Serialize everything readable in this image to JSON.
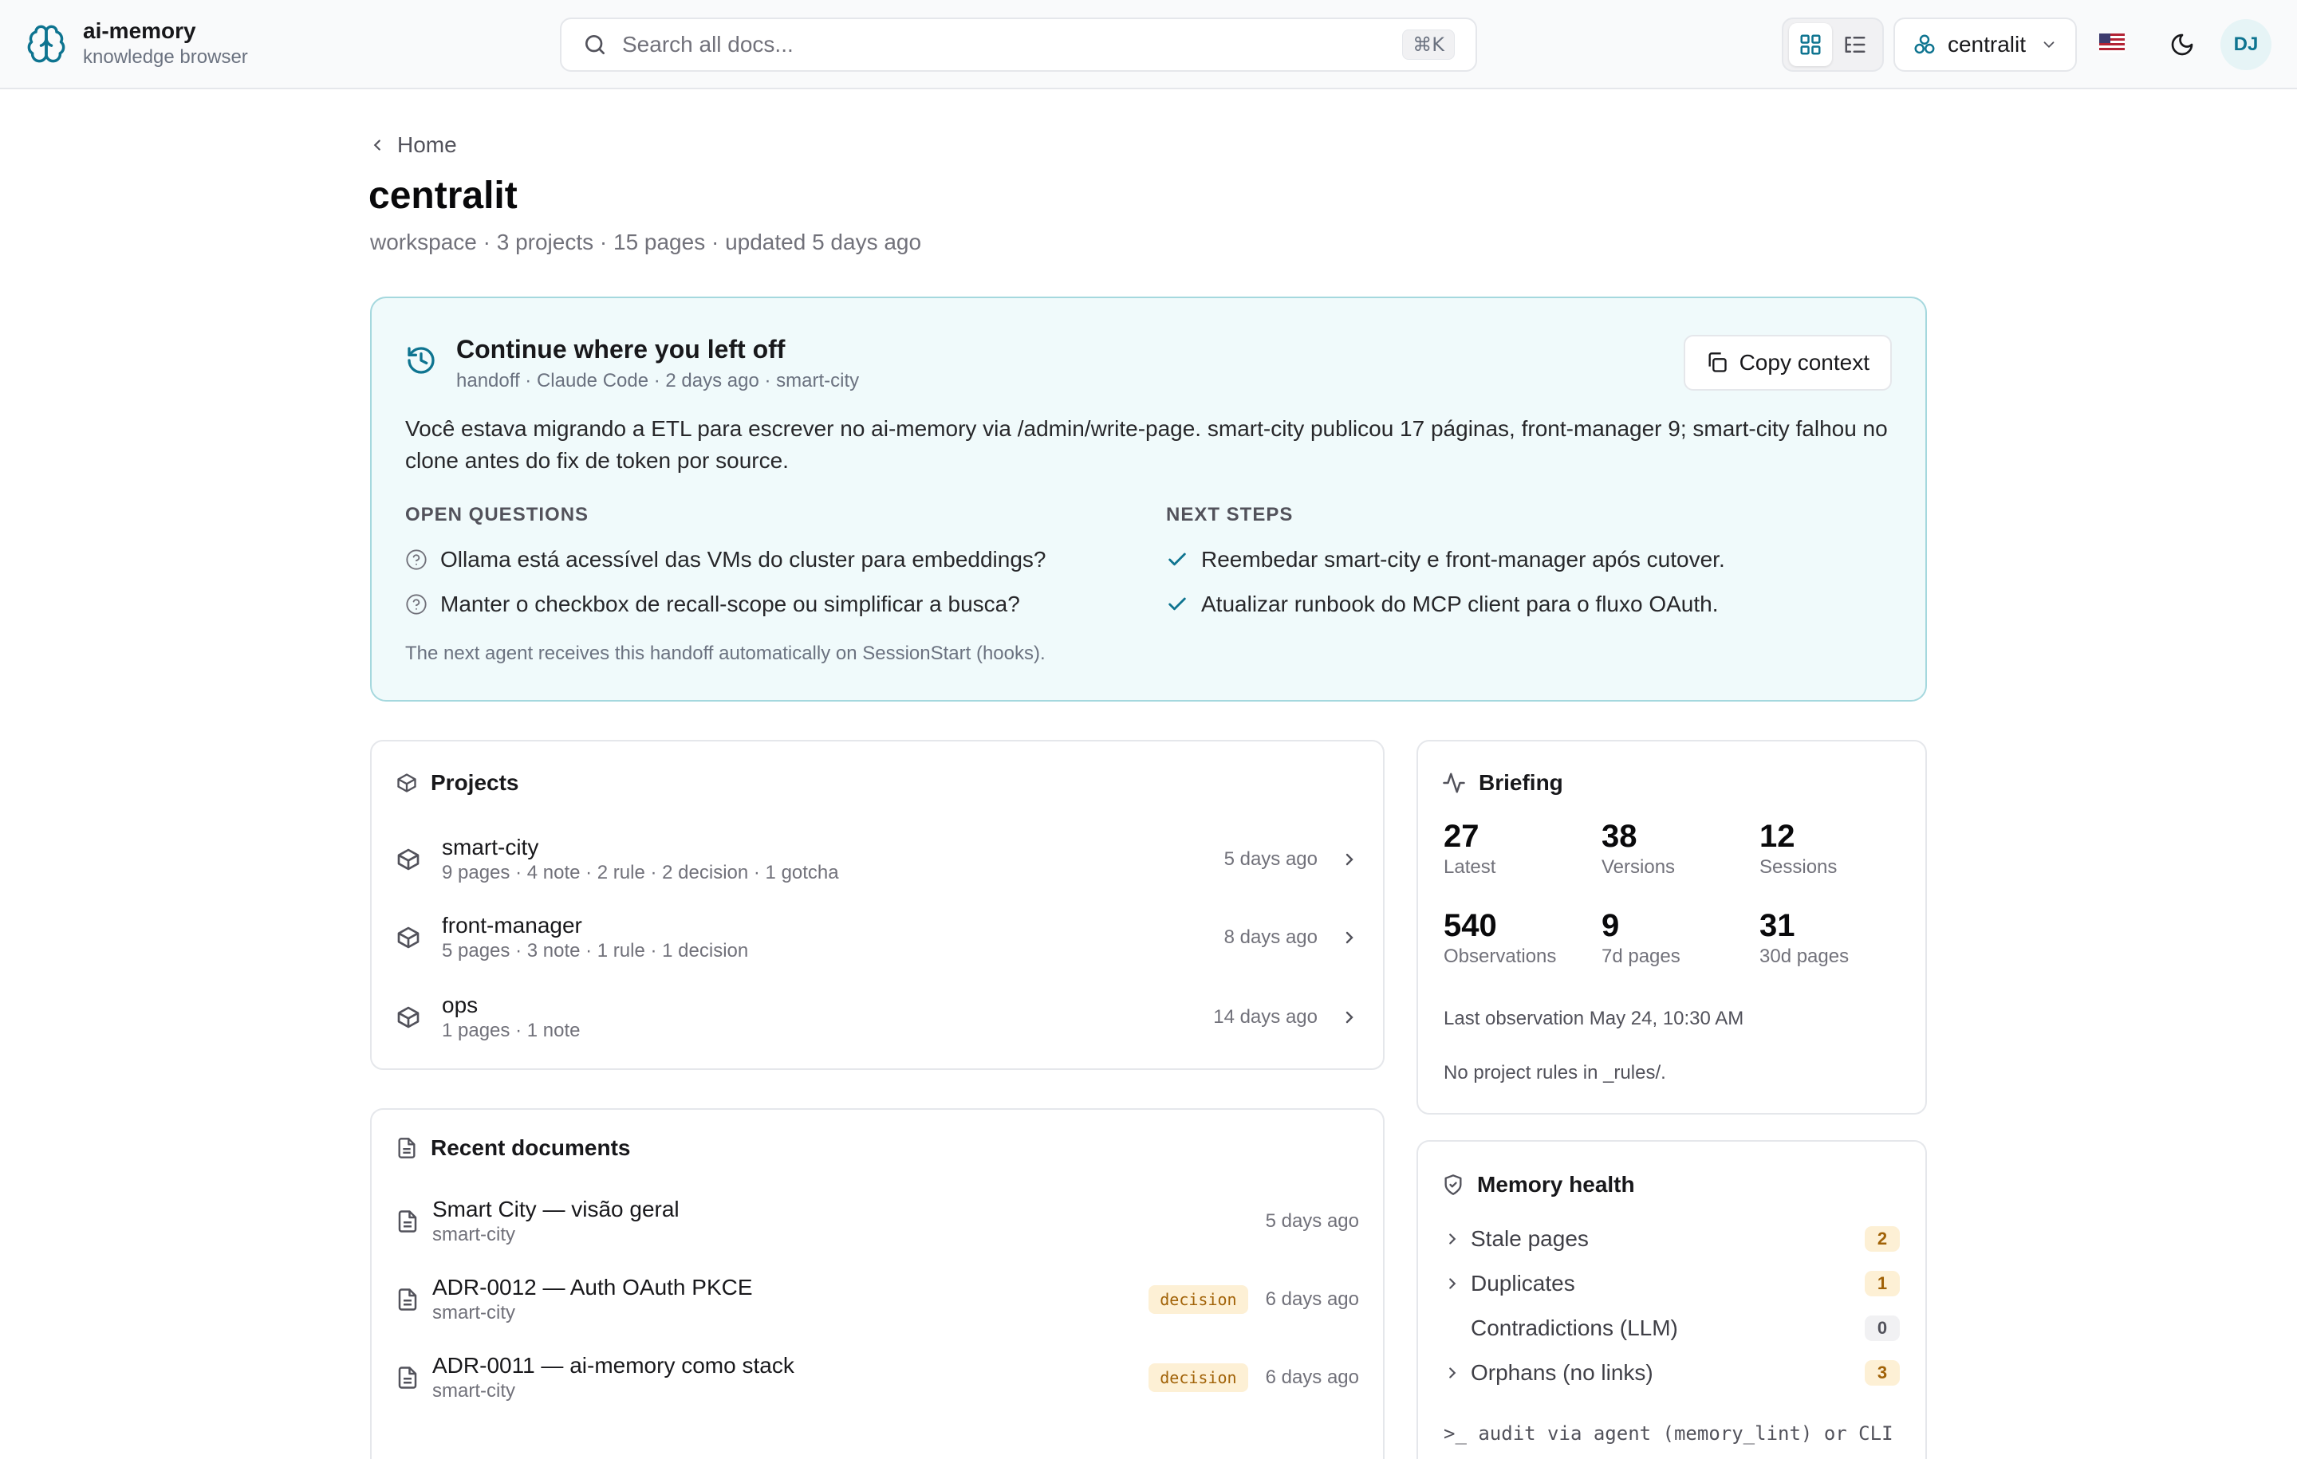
{
  "app": {
    "title": "ai-memory",
    "subtitle": "knowledge browser"
  },
  "search": {
    "placeholder": "Search all docs...",
    "shortcut": "⌘K"
  },
  "workspace_selector": {
    "value": "centralit"
  },
  "user": {
    "initials": "DJ"
  },
  "breadcrumb": {
    "back_label": "Home"
  },
  "page": {
    "title": "centralit",
    "meta": "workspace · 3 projects · 15 pages · updated 5 days ago"
  },
  "handoff": {
    "title": "Continue where you left off",
    "subtitle": "handoff · Claude Code · 2 days ago · smart-city",
    "copy_label": "Copy context",
    "summary": "Você estava migrando a ETL para escrever no ai-memory via /admin/write-page. smart-city publicou 17 páginas, front-manager 9; smart-city falhou no clone antes do fix de token por source.",
    "open_questions_heading": "OPEN QUESTIONS",
    "open_questions": [
      "Ollama está acessível das VMs do cluster para embeddings?",
      "Manter o checkbox de recall-scope ou simplificar a busca?"
    ],
    "next_steps_heading": "NEXT STEPS",
    "next_steps": [
      "Reembedar smart-city e front-manager após cutover.",
      "Atualizar runbook do MCP client para o fluxo OAuth."
    ],
    "note": "The next agent receives this handoff automatically on SessionStart (hooks)."
  },
  "projects": {
    "heading": "Projects",
    "items": [
      {
        "name": "smart-city",
        "stats": "9 pages · 4 note · 2 rule · 2 decision · 1 gotcha",
        "updated": "5 days ago"
      },
      {
        "name": "front-manager",
        "stats": "5 pages · 3 note · 1 rule · 1 decision",
        "updated": "8 days ago"
      },
      {
        "name": "ops",
        "stats": "1 pages · 1 note",
        "updated": "14 days ago"
      }
    ]
  },
  "recent_docs": {
    "heading": "Recent documents",
    "items": [
      {
        "title": "Smart City — visão geral",
        "project": "smart-city",
        "tag": "",
        "updated": "5 days ago"
      },
      {
        "title": "ADR-0012 — Auth OAuth PKCE",
        "project": "smart-city",
        "tag": "decision",
        "updated": "6 days ago"
      },
      {
        "title": "ADR-0011 — ai-memory como stack",
        "project": "smart-city",
        "tag": "decision",
        "updated": "6 days ago"
      }
    ]
  },
  "briefing": {
    "heading": "Briefing",
    "stats": [
      {
        "value": "27",
        "label": "Latest"
      },
      {
        "value": "38",
        "label": "Versions"
      },
      {
        "value": "12",
        "label": "Sessions"
      },
      {
        "value": "540",
        "label": "Observations"
      },
      {
        "value": "9",
        "label": "7d pages"
      },
      {
        "value": "31",
        "label": "30d pages"
      }
    ],
    "last_observation": "Last observation May 24, 10:30 AM",
    "rules_note": "No project rules in _rules/."
  },
  "memory_health": {
    "heading": "Memory health",
    "items": [
      {
        "label": "Stale pages",
        "count": "2"
      },
      {
        "label": "Duplicates",
        "count": "1"
      },
      {
        "label": "Contradictions (LLM)",
        "count": "0"
      },
      {
        "label": "Orphans (no links)",
        "count": "3"
      }
    ],
    "cli_hint": ">_ audit via agent (memory_lint) or CLI"
  },
  "colors": {
    "accent": "#0e7490",
    "handoff_bg": "#f0fafb",
    "handoff_border": "#a5d8de",
    "warn_bg": "#fdf0d5",
    "warn_text": "#a16207"
  },
  "icons": {
    "brand": "brain-icon",
    "search": "search-icon",
    "grid_view": "grid-icon",
    "list_view": "list-tree-icon",
    "workspace": "workspace-icon",
    "flag": "us-flag-icon",
    "theme": "moon-icon",
    "history": "history-icon",
    "copy": "copy-icon",
    "question": "question-circle-icon",
    "check": "check-icon",
    "project": "box-icon",
    "document": "file-text-icon",
    "briefing": "activity-icon",
    "health": "shield-icon",
    "chevron": "chevron-right-icon"
  }
}
